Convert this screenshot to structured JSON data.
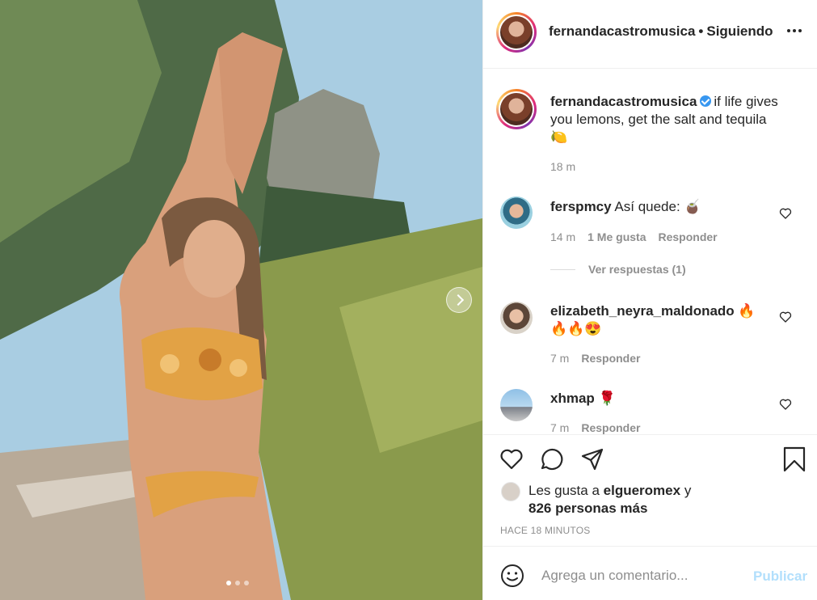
{
  "post": {
    "author": "fernandacastromusica",
    "separator": "•",
    "follow_status": "Siguiendo",
    "caption": "if life gives you lemons, get the salt and tequila",
    "caption_emoji": "🍋",
    "caption_time": "18 m"
  },
  "carousel": {
    "count": 3,
    "active_index": 0
  },
  "comments": [
    {
      "user": "ferspmcy",
      "text": "Así quede: 🧉",
      "time": "14 m",
      "likes": "1 Me gusta",
      "reply": "Responder",
      "view_replies": "Ver respuestas (1)"
    },
    {
      "user": "elizabeth_neyra_maldonado",
      "text": "🔥",
      "text2": "🔥🔥😍",
      "time": "7 m",
      "reply": "Responder"
    },
    {
      "user": "xhmap",
      "text": "🌹",
      "time": "7 m",
      "reply": "Responder"
    }
  ],
  "likes": {
    "prefix": "Les gusta a",
    "user": "elgueromex",
    "conj": "y",
    "others": "826 personas más"
  },
  "timestamp": "HACE 18 MINUTOS",
  "composer": {
    "placeholder": "Agrega un comentario...",
    "publish": "Publicar"
  },
  "colors": {
    "text": "#262626",
    "muted": "#8e8e8e",
    "publish_disabled": "#b2dffc",
    "verified": "#3897f0"
  }
}
